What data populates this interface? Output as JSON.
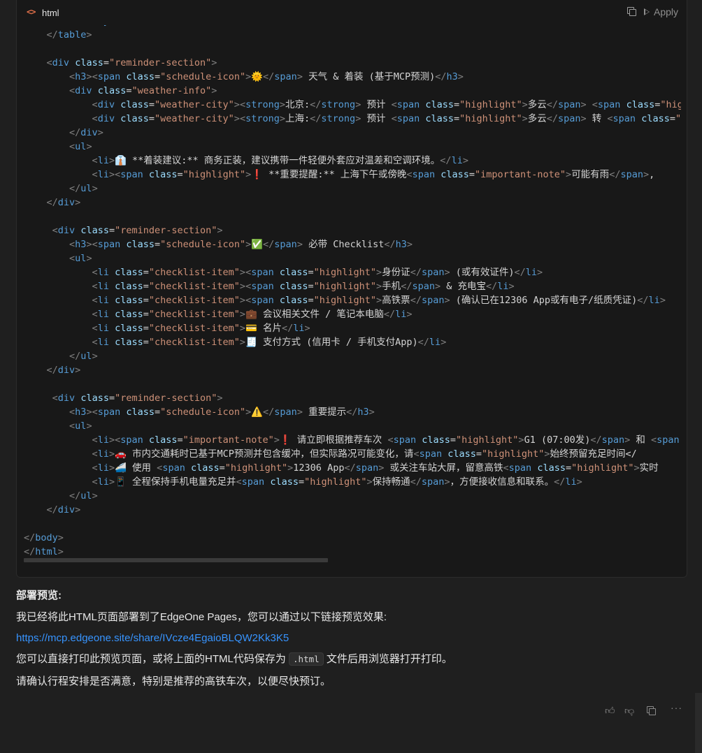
{
  "code_block": {
    "language": "html",
    "apply_label": "Apply",
    "icons": {
      "lang": "code-icon",
      "copy": "copy-icon",
      "apply": "play-icon"
    }
  },
  "code_lines": [
    {
      "t": "        </tbody>"
    },
    {
      "t": "    </table>"
    },
    {
      "t": ""
    },
    {
      "t": "    <div class=\"reminder-section\">"
    },
    {
      "t": "        <h3><span class=\"schedule-icon\">🌞</span> 天气 & 着装 (基于MCP预测)</h3>"
    },
    {
      "t": "        <div class=\"weather-info\">"
    },
    {
      "t": "            <div class=\"weather-city\"><strong>北京:</strong> 预计 <span class=\"highlight\">多云</span> <span class=\"highlight\">"
    },
    {
      "t": "            <div class=\"weather-city\"><strong>上海:</strong> 预计 <span class=\"highlight\">多云</span> 转 <span class=\"highlight\">"
    },
    {
      "t": "        </div>"
    },
    {
      "t": "        <ul>"
    },
    {
      "t": "            <li>👔 **着装建议:** 商务正装，建议携带一件轻便外套应对温差和空调环境。</li>"
    },
    {
      "t": "            <li><span class=\"highlight\">❗ **重要提醒:** 上海下午或傍晚<span class=\"important-note\">可能有雨</span>,"
    },
    {
      "t": "        </ul>"
    },
    {
      "t": "    </div>"
    },
    {
      "t": ""
    },
    {
      "t": "     <div class=\"reminder-section\">"
    },
    {
      "t": "        <h3><span class=\"schedule-icon\">✅</span> 必带 Checklist</h3>"
    },
    {
      "t": "        <ul>"
    },
    {
      "t": "            <li class=\"checklist-item\"><span class=\"highlight\">身份证</span> (或有效证件)</li>"
    },
    {
      "t": "            <li class=\"checklist-item\"><span class=\"highlight\">手机</span> & 充电宝</li>"
    },
    {
      "t": "            <li class=\"checklist-item\"><span class=\"highlight\">高铁票</span> (确认已在12306 App或有电子/纸质凭证)</li>"
    },
    {
      "t": "            <li class=\"checklist-item\">💼 会议相关文件 / 笔记本电脑</li>"
    },
    {
      "t": "            <li class=\"checklist-item\">💳 名片</li>"
    },
    {
      "t": "            <li class=\"checklist-item\">🧾 支付方式 (信用卡 / 手机支付App)</li>"
    },
    {
      "t": "        </ul>"
    },
    {
      "t": "    </div>"
    },
    {
      "t": ""
    },
    {
      "t": "     <div class=\"reminder-section\">"
    },
    {
      "t": "        <h3><span class=\"schedule-icon\">⚠️</span> 重要提示</h3>"
    },
    {
      "t": "        <ul>"
    },
    {
      "t": "            <li><span class=\"important-note\">❗ 请立即根据推荐车次 <span class=\"highlight\">G1 (07:00发)</span> 和 <span"
    },
    {
      "t": "            <li>🚗 市内交通耗时已基于MCP预测并包含缓冲，但实际路况可能变化，请<span class=\"highlight\">始终预留充足时间</"
    },
    {
      "t": "            <li>🚄 使用 <span class=\"highlight\">12306 App</span> 或关注车站大屏，留意高铁<span class=\"highlight\">实时"
    },
    {
      "t": "            <li>📱 全程保持手机电量充足并<span class=\"highlight\">保持畅通</span>，方便接收信息和联系。</li>"
    },
    {
      "t": "        </ul>"
    },
    {
      "t": "    </div>"
    },
    {
      "t": ""
    },
    {
      "t": "</body>"
    },
    {
      "t": "</html>"
    }
  ],
  "message": {
    "heading": "部署预览:",
    "intro": "我已经将此HTML页面部署到了EdgeOne Pages，您可以通过以下链接预览效果:",
    "link": "https://mcp.edgeone.site/share/IVcze4EgaioBLQW2Kk3K5",
    "print_before": "您可以直接打印此预览页面，或将上面的HTML代码保存为",
    "print_code": ".html",
    "print_after": "文件后用浏览器打开打印。",
    "confirm": "请确认行程安排是否满意，特别是推荐的高铁车次，以便尽快预订。"
  },
  "message_actions": [
    "thumbs-up-icon",
    "thumbs-down-icon",
    "copy-icon",
    "more-icon"
  ]
}
